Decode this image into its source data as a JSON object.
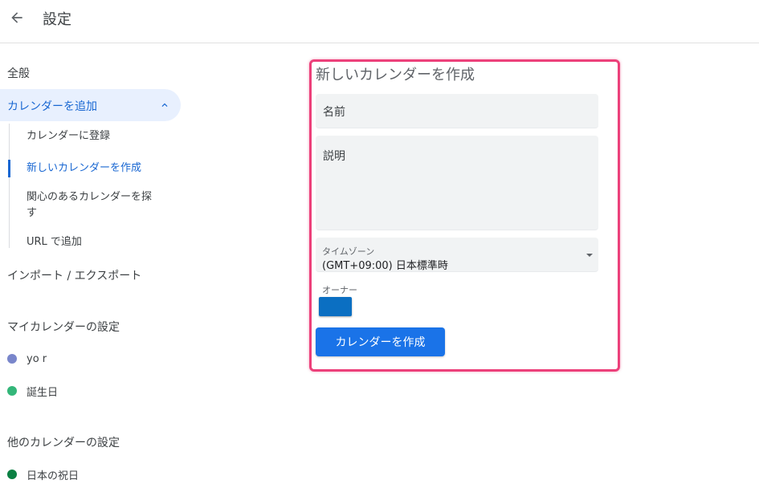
{
  "header": {
    "title": "設定"
  },
  "sidebar": {
    "general": "全般",
    "add_calendar": "カレンダーを追加",
    "sub_items": [
      "カレンダーに登録",
      "新しいカレンダーを作成",
      "関心のあるカレンダーを探",
      "す",
      "URL で追加"
    ],
    "import_export": "インポート / エクスポート",
    "my_calendars_heading": "マイカレンダーの設定",
    "my_calendars": [
      {
        "label": "yo r",
        "color": "#7986cb"
      },
      {
        "label": "誕生日",
        "color": "#33b679"
      }
    ],
    "other_calendars_heading": "他のカレンダーの設定",
    "other_calendars": [
      {
        "label": "日本の祝日",
        "color": "#0b8043"
      }
    ]
  },
  "form": {
    "title": "新しいカレンダーを作成",
    "name_label": "名前",
    "description_label": "説明",
    "timezone_label": "タイムゾーン",
    "timezone_value": "(GMT+09:00) 日本標準時",
    "owner_label": "オーナー",
    "owner_color": "#0b6fc2",
    "create_button": "カレンダーを作成",
    "highlight_color": "#ec407a"
  }
}
